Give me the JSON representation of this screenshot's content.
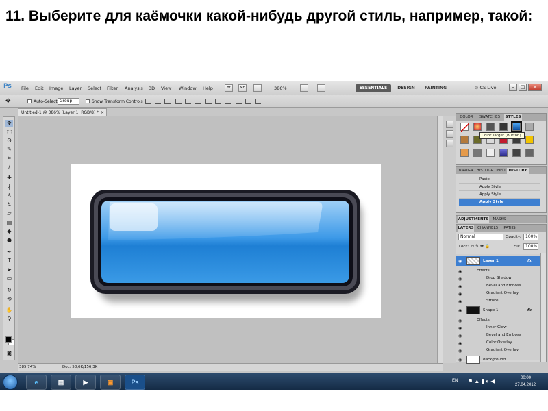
{
  "slide": {
    "title": "11. Выберите для каёмочки какой-нибудь другой стиль, например, такой:"
  },
  "app": {
    "logo": "Ps",
    "menu": [
      "File",
      "Edit",
      "Image",
      "Layer",
      "Select",
      "Filter",
      "Analysis",
      "3D",
      "View",
      "Window",
      "Help"
    ],
    "menu_buttons": [
      "Br",
      "Mb"
    ],
    "zoom": "386%",
    "workspaces": [
      "ESSENTIALS",
      "DESIGN",
      "PAINTING"
    ],
    "cs_live": "CS Live",
    "window_controls": [
      "–",
      "□",
      "×"
    ]
  },
  "options": {
    "auto_select_label": "Auto-Select:",
    "auto_select_value": "Group",
    "transform_label": "Show Transform Controls"
  },
  "document": {
    "tab_title": "Untitled-1 @ 386% (Layer 1, RGB/8) *",
    "status_zoom": "385.74%",
    "status_doc": "Doc: 58,6K/156,3K"
  },
  "panels": {
    "top_tabs": [
      "COLOR",
      "SWATCHES",
      "STYLES"
    ],
    "tooltip": "Color Target (Button)",
    "history_tabs": [
      "NAVIGA",
      "HISTOGR",
      "INFO",
      "HISTORY"
    ],
    "history": [
      "Paste",
      "Apply Style",
      "Apply Style",
      "Apply Style"
    ],
    "adj_tabs": [
      "ADJUSTMENTS",
      "MASKS"
    ],
    "layer_tabs": [
      "LAYERS",
      "CHANNELS",
      "PATHS"
    ],
    "blend_mode": "Normal",
    "opacity_label": "Opacity:",
    "opacity": "100%",
    "lock_label": "Lock:",
    "fill_label": "Fill:",
    "fill": "100%",
    "layers": [
      {
        "name": "Layer 1",
        "kind": "layer",
        "fx": "fx"
      },
      {
        "name": "Effects",
        "kind": "effects"
      },
      {
        "name": "Drop Shadow",
        "kind": "effect"
      },
      {
        "name": "Bevel and Emboss",
        "kind": "effect"
      },
      {
        "name": "Gradient Overlay",
        "kind": "effect"
      },
      {
        "name": "Stroke",
        "kind": "effect"
      },
      {
        "name": "Shape 1",
        "kind": "layer",
        "fx": "fx"
      },
      {
        "name": "Effects",
        "kind": "effects"
      },
      {
        "name": "Inner Glow",
        "kind": "effect"
      },
      {
        "name": "Bevel and Emboss",
        "kind": "effect"
      },
      {
        "name": "Color Overlay",
        "kind": "effect"
      },
      {
        "name": "Gradient Overlay",
        "kind": "effect"
      },
      {
        "name": "Background",
        "kind": "background"
      }
    ]
  },
  "taskbar": {
    "ps_label": "Ps",
    "lang": "EN",
    "time": "00:00",
    "date": "27.04.2012"
  },
  "colors": {
    "ps_blue": "#3d83c5",
    "selection": "#3d7fd1",
    "button_blue": "#2f8fe3",
    "taskbar": "#1f3a5a"
  },
  "icons": [
    "move-icon",
    "marquee-icon",
    "lasso-icon",
    "quick-select-icon",
    "crop-icon",
    "eyedropper-icon",
    "healing-icon",
    "brush-icon",
    "stamp-icon",
    "history-brush-icon",
    "eraser-icon",
    "gradient-icon",
    "blur-icon",
    "dodge-icon",
    "pen-icon",
    "type-icon",
    "path-select-icon",
    "shape-icon",
    "3d-rotate-icon",
    "3d-orbit-icon",
    "hand-icon",
    "zoom-icon"
  ]
}
